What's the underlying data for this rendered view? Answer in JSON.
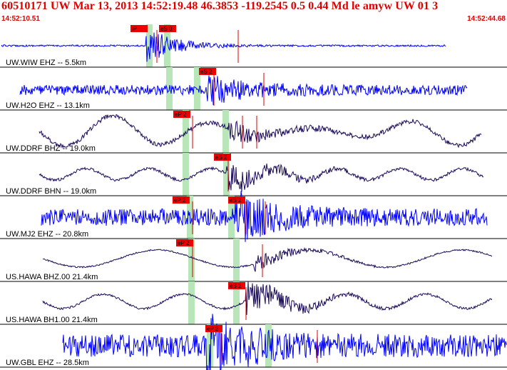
{
  "header": {
    "title": "60510171 UW Mar 13, 2013 14:52:19.48    46.3853 -119.2545   0.5 0.44 Md le amyw UW 01    3",
    "start_time": "14:52:10.51",
    "end_time": "14:52:44.68"
  },
  "colors": {
    "header_text": "#e00000",
    "trace_blue": "#0000ff",
    "trace_dark": "#1a0a5a",
    "pick_box": "#ee0000",
    "pick_line": "#dd0000",
    "window_band": "#b8e6b8"
  },
  "channels": [
    {
      "label": "UW.WIW EHZ -- 5.5km",
      "color": "blue",
      "picks": [
        {
          "label": "iP",
          "flag": ""
        },
        {
          "label": "eS",
          "flag": "0"
        }
      ]
    },
    {
      "label": "UW.H2O EHZ -- 13.1km",
      "color": "blue",
      "picks": [
        {
          "label": "eS",
          "flag": "2"
        }
      ]
    },
    {
      "label": "UW.DDRF BHZ -- 19.0km",
      "color": "dark",
      "picks": [
        {
          "label": "eP",
          "flag": "2"
        }
      ]
    },
    {
      "label": "UW.DDRF BHN -- 19.0km",
      "color": "dark",
      "picks": [
        {
          "label": "eS",
          "flag": "2"
        }
      ]
    },
    {
      "label": "UW.MJ2 EHZ -- 20.8km",
      "color": "blue",
      "picks": [
        {
          "label": "eP",
          "flag": "2"
        },
        {
          "label": "eS",
          "flag": "2"
        }
      ]
    },
    {
      "label": "US.HAWA BHZ.00 21.4km",
      "color": "dark",
      "picks": [
        {
          "label": "eP",
          "flag": "2"
        }
      ]
    },
    {
      "label": "US.HAWA BH1.00 21.4km",
      "color": "dark",
      "picks": [
        {
          "label": "eS",
          "flag": "2"
        }
      ]
    },
    {
      "label": "UW.GBL EHZ -- 28.5km",
      "color": "blue",
      "picks": [
        {
          "label": "eP",
          "flag": "2"
        }
      ]
    }
  ]
}
